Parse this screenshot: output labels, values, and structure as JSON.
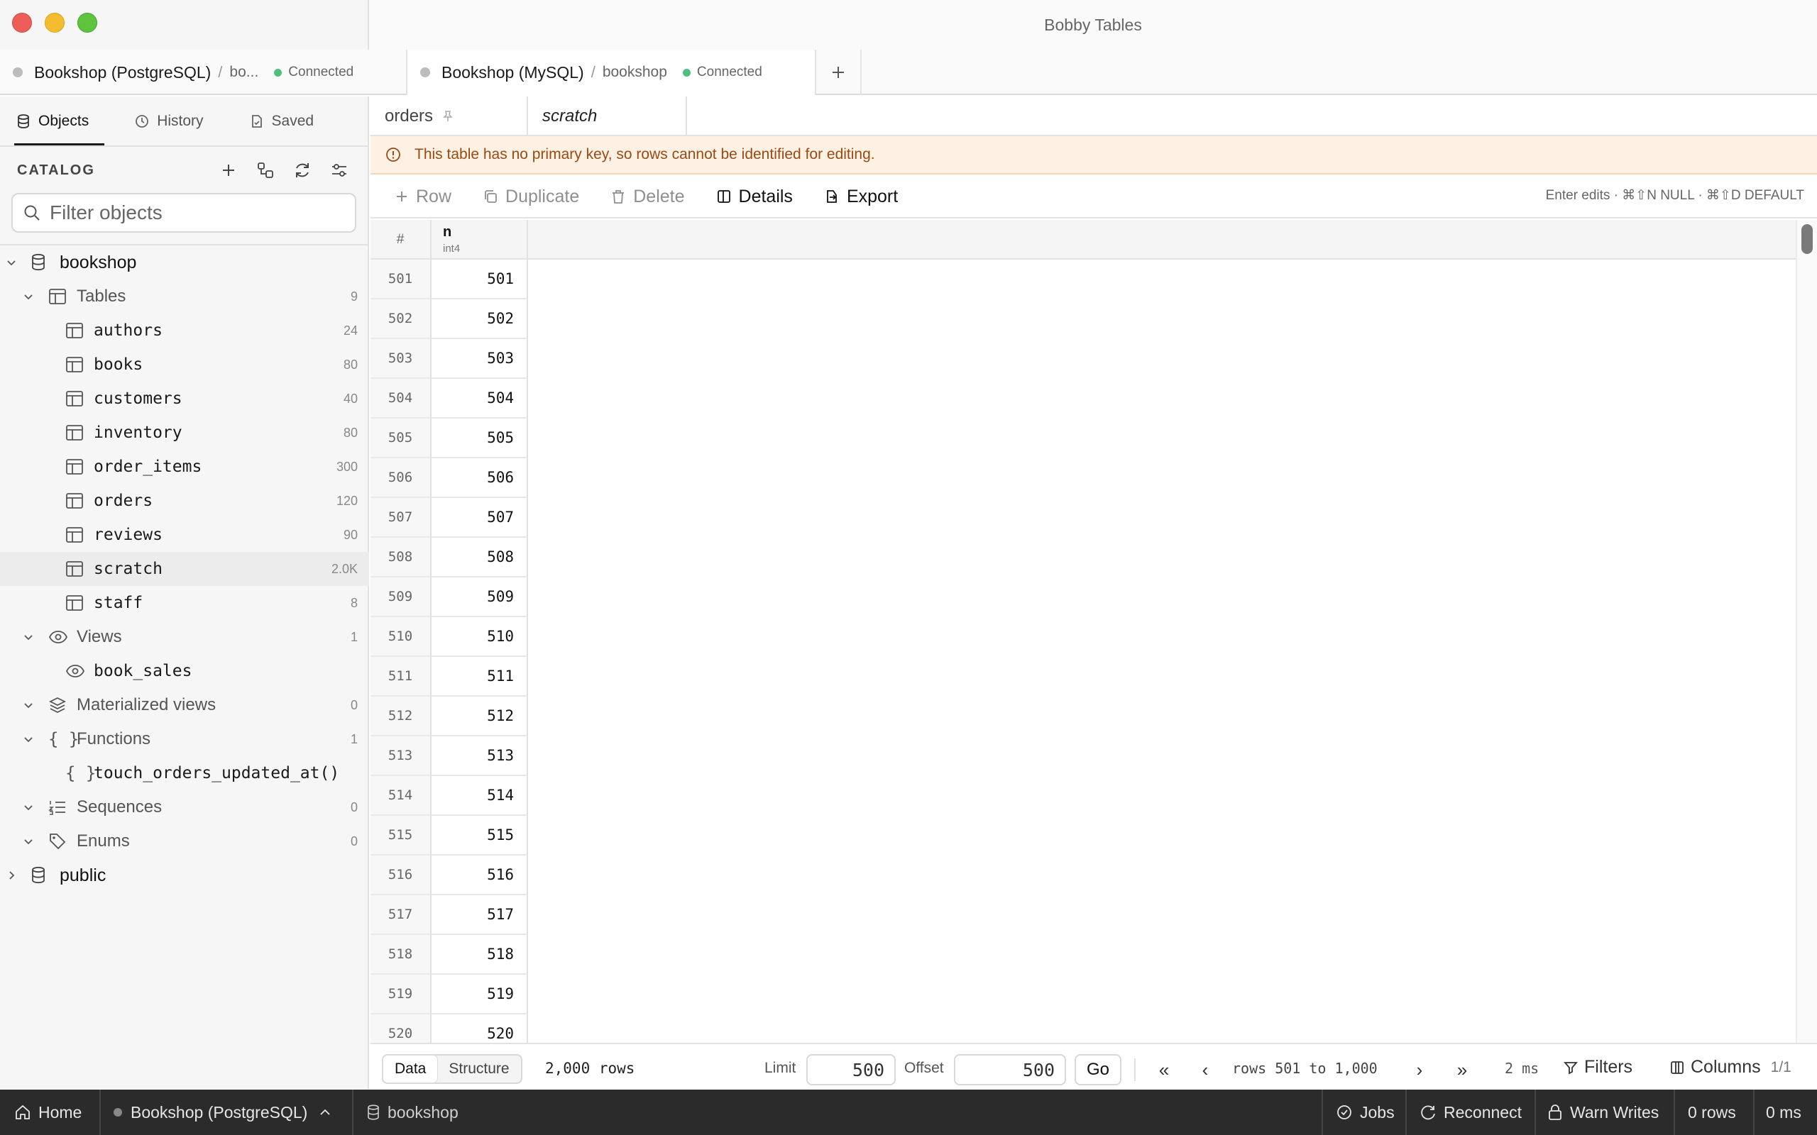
{
  "window": {
    "title": "Bobby Tables"
  },
  "connections": [
    {
      "name": "Bookshop (PostgreSQL)",
      "db": "bo...",
      "status": "Connected"
    },
    {
      "name": "Bookshop (MySQL)",
      "db": "bookshop",
      "status": "Connected"
    }
  ],
  "left_tabs": {
    "objects": "Objects",
    "history": "History",
    "saved": "Saved"
  },
  "catalog": {
    "label": "CATALOG",
    "filter_placeholder": "Filter objects",
    "databases": [
      {
        "name": "bookshop"
      },
      {
        "name": "public"
      }
    ],
    "groups": {
      "tables": {
        "label": "Tables",
        "count": "9"
      },
      "views": {
        "label": "Views",
        "count": "1"
      },
      "matviews": {
        "label": "Materialized views",
        "count": "0"
      },
      "functions": {
        "label": "Functions",
        "count": "1"
      },
      "sequences": {
        "label": "Sequences",
        "count": "0"
      },
      "enums": {
        "label": "Enums",
        "count": "0"
      }
    },
    "tables": [
      {
        "name": "authors",
        "count": "24"
      },
      {
        "name": "books",
        "count": "80"
      },
      {
        "name": "customers",
        "count": "40"
      },
      {
        "name": "inventory",
        "count": "80"
      },
      {
        "name": "order_items",
        "count": "300"
      },
      {
        "name": "orders",
        "count": "120"
      },
      {
        "name": "reviews",
        "count": "90"
      },
      {
        "name": "scratch",
        "count": "2.0K"
      },
      {
        "name": "staff",
        "count": "8"
      }
    ],
    "views": [
      {
        "name": "book_sales"
      }
    ],
    "functions": [
      {
        "name": "touch_orders_updated_at()"
      }
    ]
  },
  "query_tabs": [
    {
      "name": "orders"
    },
    {
      "name": "scratch"
    }
  ],
  "warning": "This table has no primary key, so rows cannot be identified for editing.",
  "toolbar": {
    "row": "Row",
    "duplicate": "Duplicate",
    "delete": "Delete",
    "details": "Details",
    "export": "Export",
    "hint": "Enter edits · ⌘⇧N NULL · ⌘⇧D DEFAULT"
  },
  "grid": {
    "row_num_header": "#",
    "column": {
      "name": "n",
      "type": "int4"
    },
    "rows": [
      [
        "501",
        "501"
      ],
      [
        "502",
        "502"
      ],
      [
        "503",
        "503"
      ],
      [
        "504",
        "504"
      ],
      [
        "505",
        "505"
      ],
      [
        "506",
        "506"
      ],
      [
        "507",
        "507"
      ],
      [
        "508",
        "508"
      ],
      [
        "509",
        "509"
      ],
      [
        "510",
        "510"
      ],
      [
        "511",
        "511"
      ],
      [
        "512",
        "512"
      ],
      [
        "513",
        "513"
      ],
      [
        "514",
        "514"
      ],
      [
        "515",
        "515"
      ],
      [
        "516",
        "516"
      ],
      [
        "517",
        "517"
      ],
      [
        "518",
        "518"
      ],
      [
        "519",
        "519"
      ],
      [
        "520",
        "520"
      ]
    ]
  },
  "pager": {
    "data": "Data",
    "structure": "Structure",
    "total_rows": "2,000 rows",
    "limit_label": "Limit",
    "limit_value": "500",
    "offset_label": "Offset",
    "offset_value": "500",
    "go": "Go",
    "range": "rows 501 to 1,000",
    "elapsed": "2 ms",
    "filters": "Filters",
    "columns": "Columns",
    "columns_count": "1/1"
  },
  "status_bar": {
    "home": "Home",
    "connection": "Bookshop (PostgreSQL)",
    "database": "bookshop",
    "jobs": "Jobs",
    "reconnect": "Reconnect",
    "warn_writes": "Warn Writes",
    "rows": "0 rows",
    "time": "0 ms"
  },
  "colors": {
    "accent_connected": "#4fbf7f",
    "warning_bg": "#fdf1e3",
    "warning_text": "#9a4a14",
    "status_bg": "#2b2b2b"
  }
}
